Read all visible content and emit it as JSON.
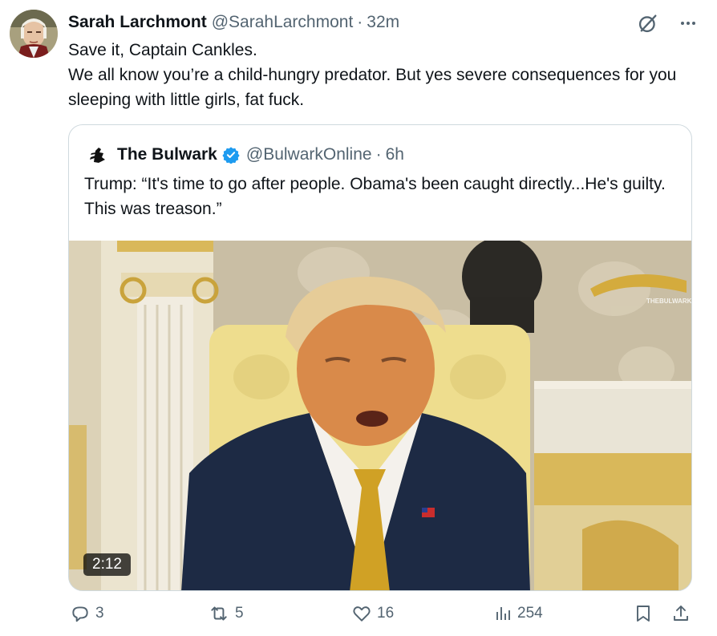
{
  "tweet": {
    "author_name": "Sarah Larchmont",
    "author_handle": "@SarahLarchmont",
    "separator": "·",
    "time": "32m",
    "text_line1": "Save it, Captain Cankles.",
    "text_line2": "We all know you’re a child-hungry predator. But yes severe consequences for you sleeping with little girls, fat fuck."
  },
  "quote": {
    "author_name": "The Bulwark",
    "author_handle": "@BulwarkOnline",
    "separator": "·",
    "time": "6h",
    "text": "Trump: “It's time to go after people. Obama's been caught directly...He's guilty. This was treason.”",
    "media": {
      "duration": "2:12",
      "watermark": "THEBULWARK"
    }
  },
  "actions": {
    "replies": "3",
    "reposts": "5",
    "likes": "16",
    "views": "254"
  },
  "icons": {
    "top_right": [
      "grok-icon",
      "more-icon"
    ],
    "action_bar": [
      "reply-icon",
      "repost-icon",
      "like-icon",
      "views-icon",
      "bookmark-icon",
      "share-icon"
    ]
  },
  "colors": {
    "text_primary": "#0f1419",
    "text_secondary": "#536471",
    "border": "#cfd9de",
    "verified_blue": "#1d9bf0"
  }
}
